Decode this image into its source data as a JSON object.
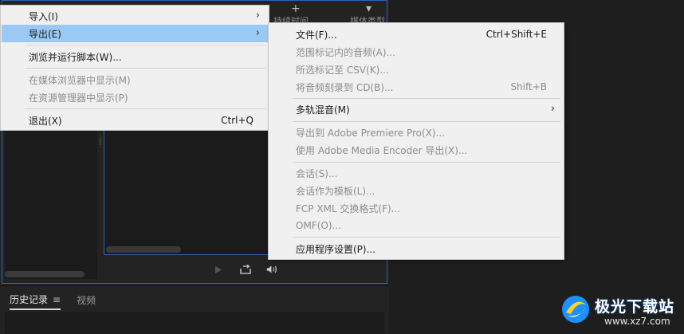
{
  "background": {
    "header_icons": [
      "+",
      "▾"
    ],
    "header_texts": [
      "持续时间",
      "媒体类型"
    ]
  },
  "file_menu": {
    "items": [
      {
        "label": "导入(I)",
        "has_submenu": true,
        "enabled": true
      },
      {
        "label": "导出(E)",
        "has_submenu": true,
        "enabled": true,
        "highlighted": true
      },
      {
        "label": "浏览并运行脚本(W)...",
        "enabled": true
      },
      {
        "label": "在媒体浏览器中显示(M)",
        "enabled": false
      },
      {
        "label": "在资源管理器中显示(P)",
        "enabled": false
      },
      {
        "label": "退出(X)",
        "shortcut": "Ctrl+Q",
        "enabled": true
      }
    ]
  },
  "export_submenu": {
    "items": [
      {
        "label": "文件(F)...",
        "shortcut": "Ctrl+Shift+E",
        "enabled": true
      },
      {
        "label": "范围标记内的音频(A)...",
        "enabled": false
      },
      {
        "label": "所选标记至 CSV(K)...",
        "enabled": false
      },
      {
        "label": "将音频刻录到 CD(B)...",
        "shortcut": "Shift+B",
        "enabled": false
      },
      {
        "label": "多轨混音(M)",
        "has_submenu": true,
        "enabled": true
      },
      {
        "label": "导出到 Adobe Premiere Pro(X)...",
        "enabled": false
      },
      {
        "label": "使用 Adobe Media Encoder 导出(X)...",
        "enabled": false
      },
      {
        "label": "会话(S)...",
        "enabled": false
      },
      {
        "label": "会话作为模板(L)...",
        "enabled": false
      },
      {
        "label": "FCP XML 交换格式(F)...",
        "enabled": false
      },
      {
        "label": "OMF(O)...",
        "enabled": false
      },
      {
        "label": "应用程序设置(P)...",
        "enabled": true
      }
    ]
  },
  "history_panel": {
    "tabs": [
      {
        "label": "历史记录",
        "active": true
      },
      {
        "label": "视频",
        "active": false
      }
    ]
  },
  "watermark": {
    "title": "极光下载站",
    "url": "www.xz7.com"
  },
  "colors": {
    "highlight": "#99c9f4",
    "menu_bg": "#f0f0f0",
    "panel_border": "#2e63b3",
    "disabled_text": "#8d8d8d"
  }
}
